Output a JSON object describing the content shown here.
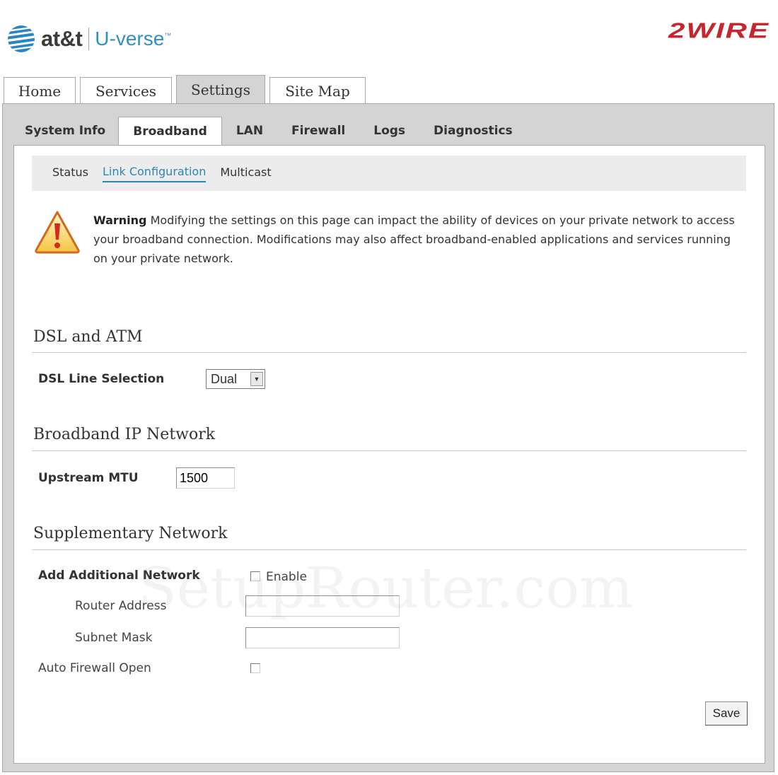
{
  "header": {
    "att_brand": "at&t",
    "product": "U-verse",
    "trademark": "™",
    "vendor_logo": "2WIRE"
  },
  "top_tabs": [
    {
      "label": "Home",
      "active": false
    },
    {
      "label": "Services",
      "active": false
    },
    {
      "label": "Settings",
      "active": true
    },
    {
      "label": "Site Map",
      "active": false
    }
  ],
  "sub_tabs": [
    {
      "label": "System Info",
      "active": false
    },
    {
      "label": "Broadband",
      "active": true
    },
    {
      "label": "LAN",
      "active": false
    },
    {
      "label": "Firewall",
      "active": false
    },
    {
      "label": "Logs",
      "active": false
    },
    {
      "label": "Diagnostics",
      "active": false
    }
  ],
  "nav3": [
    {
      "label": "Status",
      "active": false
    },
    {
      "label": "Link Configuration",
      "active": true
    },
    {
      "label": "Multicast",
      "active": false
    }
  ],
  "warning": {
    "icon": "warning-triangle-icon",
    "title": "Warning",
    "text": "Modifying the settings on this page can impact the ability of devices on your private network to access your broadband connection. Modifications may also affect broadband-enabled applications and services running on your private network."
  },
  "dsl": {
    "section_title": "DSL and ATM",
    "line_selection_label": "DSL Line Selection",
    "line_selection_value": "Dual"
  },
  "ip_network": {
    "section_title": "Broadband IP Network",
    "mtu_label": "Upstream MTU",
    "mtu_value": "1500"
  },
  "supplementary": {
    "section_title": "Supplementary Network",
    "add_network_label": "Add Additional Network",
    "enable_label": "Enable",
    "enable_checked": false,
    "router_address_label": "Router Address",
    "router_address_value": "",
    "subnet_mask_label": "Subnet Mask",
    "subnet_mask_value": "",
    "auto_firewall_label": "Auto Firewall Open",
    "auto_firewall_checked": false
  },
  "save_label": "Save",
  "watermark": "SetupRouter.com",
  "colors": {
    "accent_blue": "#2e86b5",
    "brand_red": "#c4262e",
    "frame_gray": "#d4d4d4"
  }
}
